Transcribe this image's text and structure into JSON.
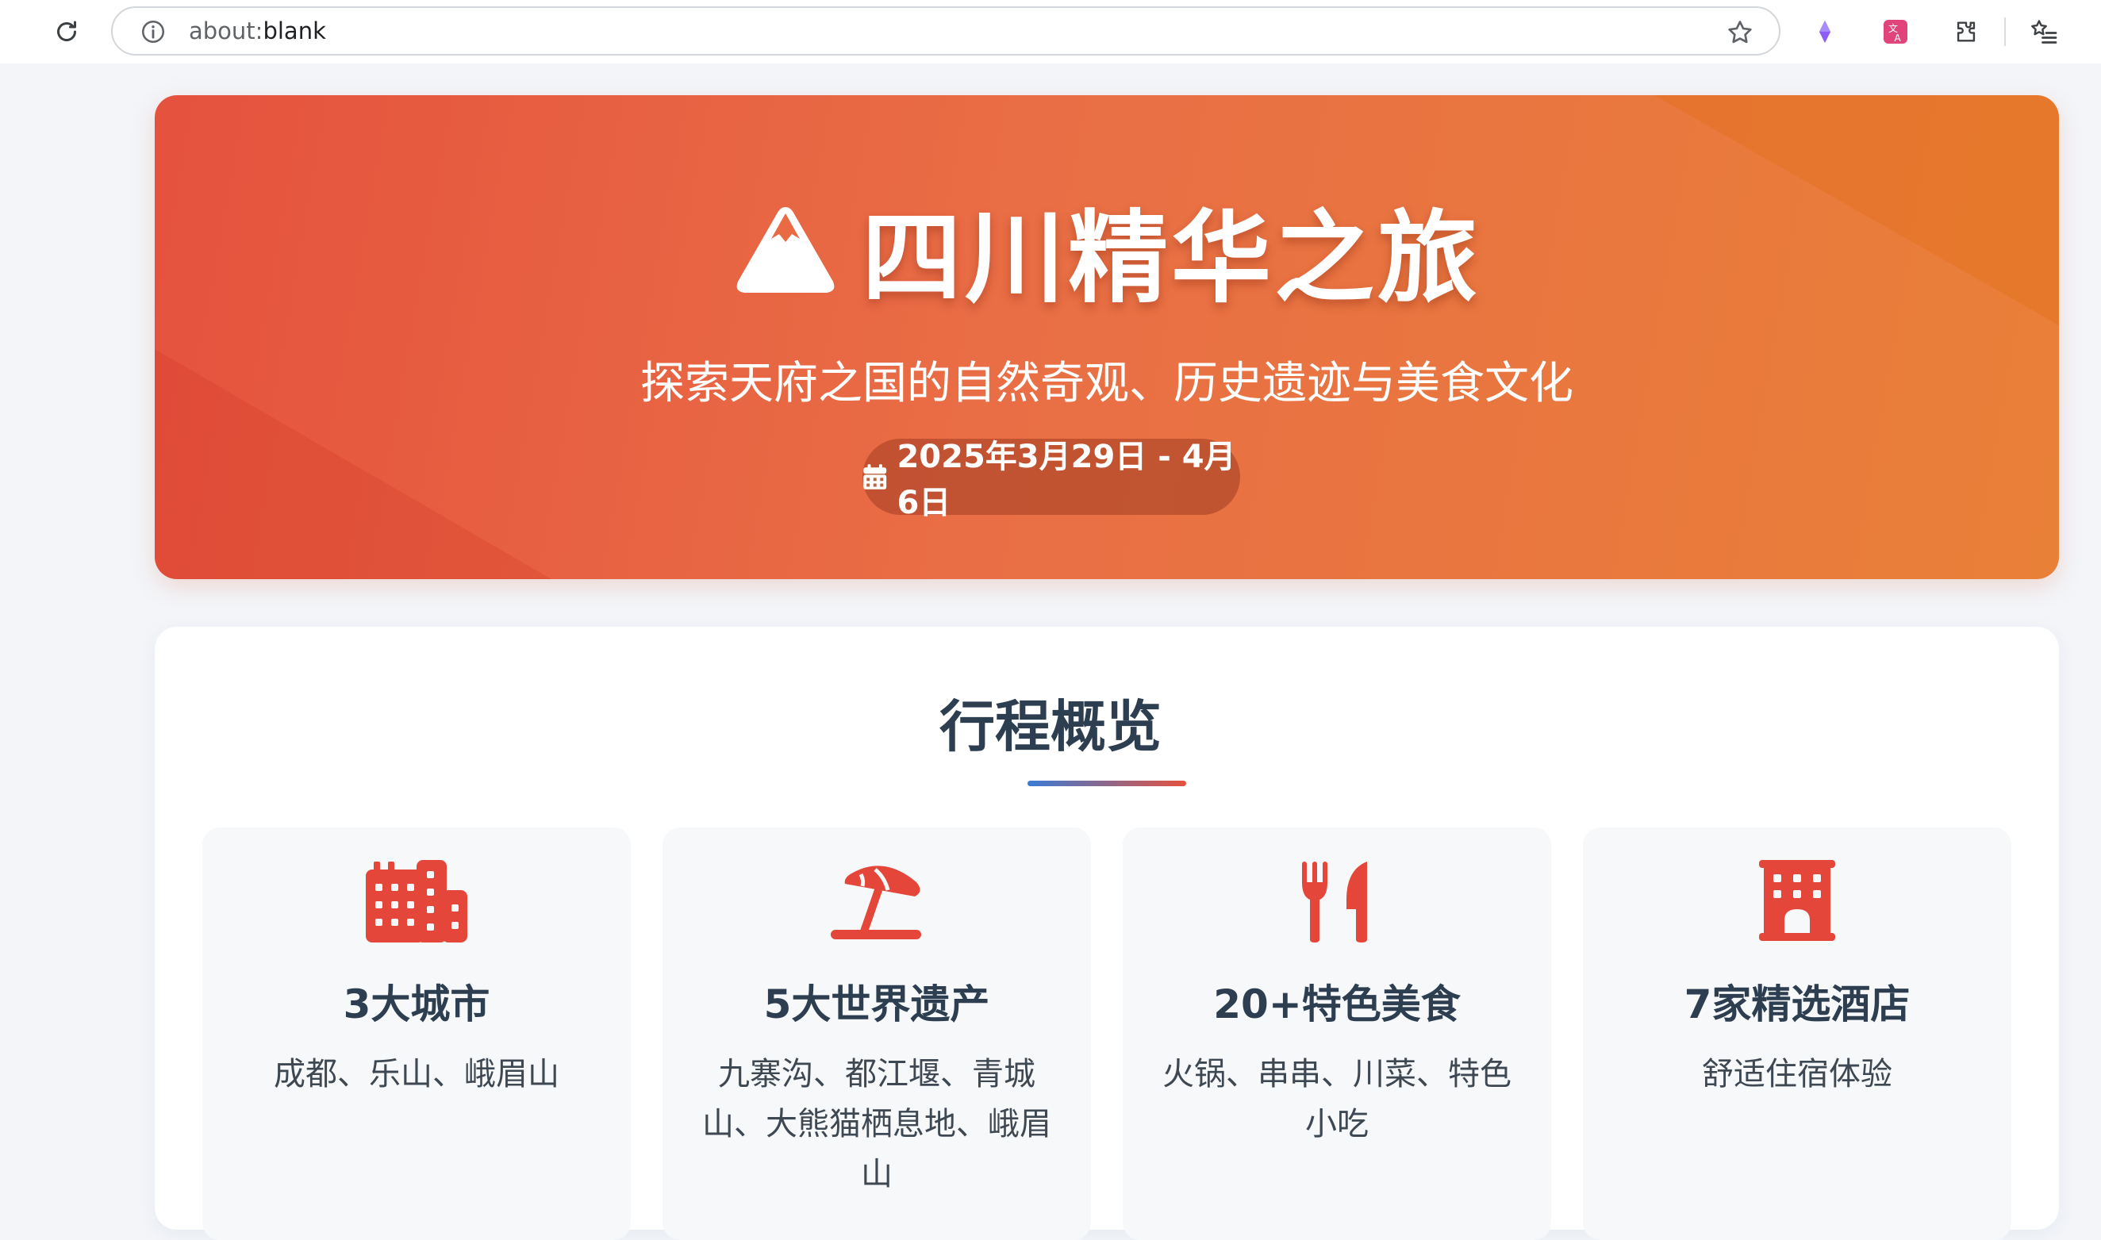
{
  "browser": {
    "url_scheme": "about:",
    "url_rest": "blank"
  },
  "hero": {
    "title": "四川精华之旅",
    "subtitle": "探索天府之国的自然奇观、历史遗迹与美食文化",
    "date": "2025年3月29日 - 4月6日",
    "gradient_start": "#e5523e",
    "gradient_end": "#e98038"
  },
  "overview": {
    "title": "行程概览",
    "cards": [
      {
        "icon": "city-icon",
        "title": "3大城市",
        "desc": "成都、乐山、峨眉山"
      },
      {
        "icon": "beach-umbrella-icon",
        "title": "5大世界遗产",
        "desc": "九寨沟、都江堰、青城山、大熊猫栖息地、峨眉山"
      },
      {
        "icon": "utensils-icon",
        "title": "20+特色美食",
        "desc": "火锅、串串、川菜、特色小吃"
      },
      {
        "icon": "hotel-icon",
        "title": "7家精选酒店",
        "desc": "舒适住宿体验"
      }
    ],
    "accent": "#e5463a",
    "heading_color": "#2c3e50"
  }
}
